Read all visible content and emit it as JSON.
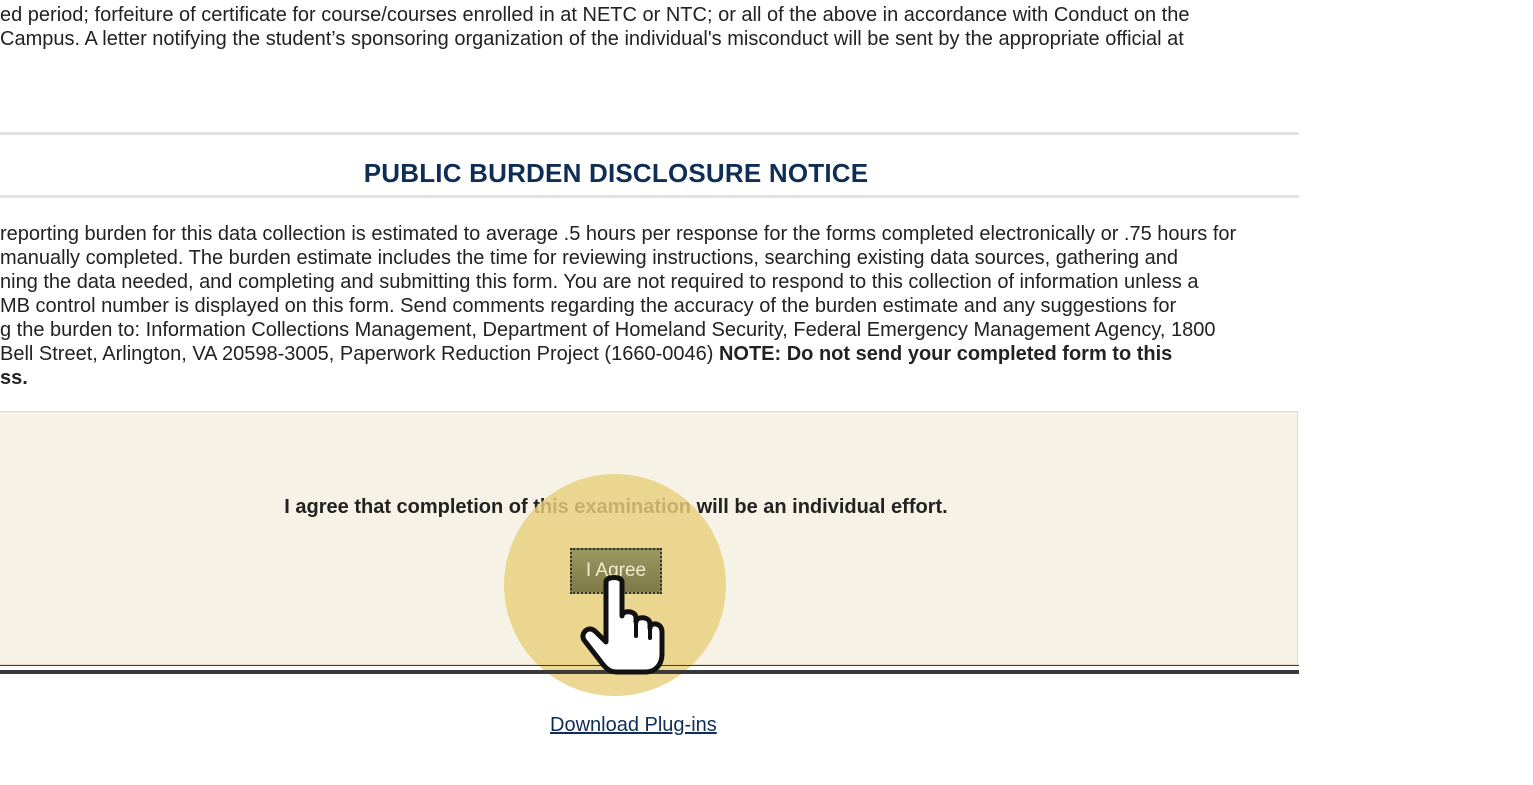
{
  "conduct_text": {
    "lines": [
      "ed period; forfeiture of certificate for course/courses enrolled in at NETC or NTC; or all of the above in accordance with Conduct on the",
      "Campus. A letter notifying the student’s sponsoring organization of the individual's misconduct will be sent by the appropriate official at"
    ]
  },
  "burden_notice": {
    "title": "PUBLIC BURDEN DISCLOSURE NOTICE",
    "lines": [
      "reporting burden for this data collection is estimated to average .5 hours per response for the forms completed electronically or .75 hours for",
      "manually completed. The burden estimate includes the time for reviewing instructions, searching existing data sources, gathering and",
      "ning the data needed, and completing and submitting this form. You are not required to respond to this collection of information unless a",
      "MB control number is displayed on this form. Send comments regarding the accuracy of the burden estimate and any suggestions for",
      "g the burden to: Information Collections Management, Department of Homeland Security, Federal Emergency Management Agency, 1800"
    ],
    "line6_normal": "Bell Street, Arlington, VA 20598-3005, Paperwork Reduction Project (1660-0046) ",
    "line6_bold": "NOTE: Do not send your completed form to this",
    "line7_bold": "ss."
  },
  "agreement": {
    "statement": "I agree that completion of this examination will be an individual effort.",
    "button_label": "I Agree"
  },
  "footer": {
    "link_label": "Download Plug-ins"
  },
  "icons": {
    "pointer": "hand-pointer-cursor-icon"
  },
  "colors": {
    "title": "#0f2e57",
    "panel_background": "#f6f2e5",
    "button": "#8a8754",
    "button_text": "#f5ead0",
    "highlight": "#e8cf7c"
  }
}
